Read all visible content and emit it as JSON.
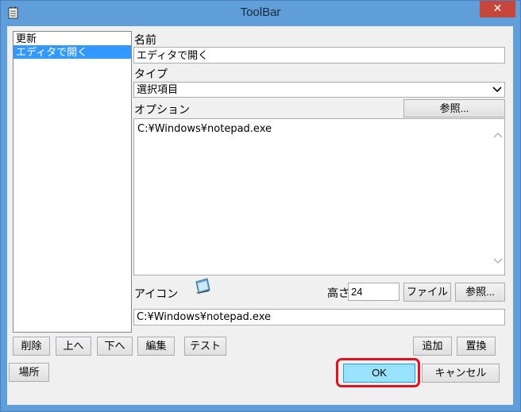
{
  "window": {
    "title": "ToolBar",
    "close_glyph": "✕"
  },
  "list": {
    "items": [
      "更新",
      "エディタで開く"
    ],
    "selected_index": 1
  },
  "form": {
    "name_label": "名前",
    "name_value": "エディタで開く",
    "type_label": "タイプ",
    "type_value": "選択項目",
    "option_label": "オプション",
    "option_browse_label": "参照...",
    "option_value": "C:¥Windows¥notepad.exe",
    "icon_label": "アイコン",
    "height_label": "高さ",
    "height_value": "24",
    "file_button_label": "ファイル",
    "icon_browse_label": "参照...",
    "icon_path_value": "C:¥Windows¥notepad.exe"
  },
  "list_buttons": {
    "delete": "削除",
    "up": "上へ",
    "down": "下へ",
    "edit": "編集",
    "test": "テスト",
    "add": "追加",
    "replace": "置換"
  },
  "footer": {
    "location": "場所",
    "ok": "OK",
    "cancel": "キャンセル"
  },
  "colors": {
    "title_bar": "#5f9ed8",
    "close": "#c7463c",
    "selection": "#3399ff",
    "ok_button": "#99e3ff",
    "highlight": "#e0141e"
  },
  "icons": [
    "notepad-icon",
    "close-icon",
    "chevron-down-icon",
    "scroll-up-icon",
    "scroll-down-icon"
  ]
}
